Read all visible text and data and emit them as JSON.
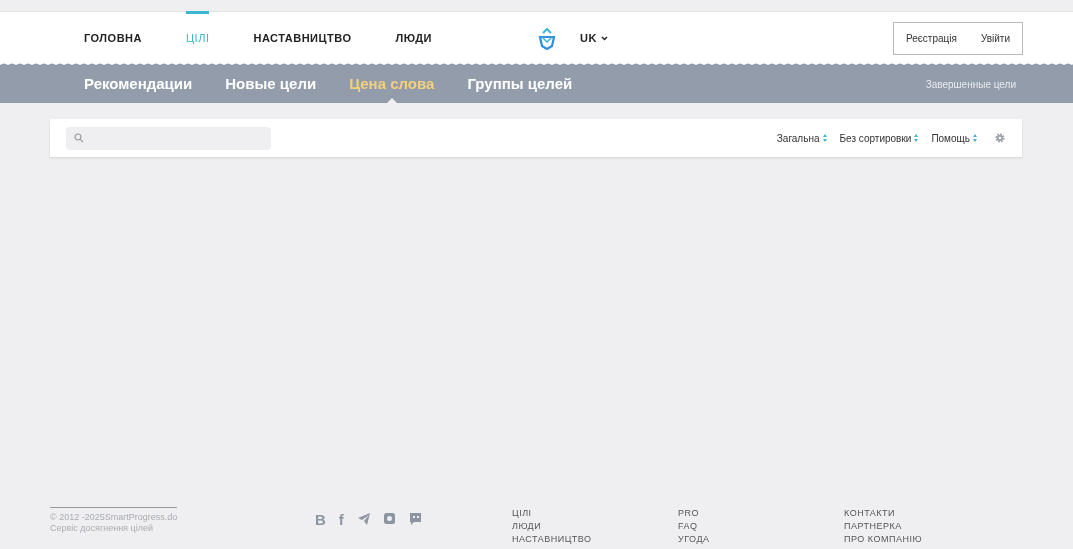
{
  "top_nav": {
    "items": [
      {
        "label": "ГОЛОВНА",
        "selected": false
      },
      {
        "label": "ЦІЛІ",
        "selected": true
      },
      {
        "label": "НАСТАВНИЦТВО",
        "selected": false
      },
      {
        "label": "ЛЮДИ",
        "selected": false
      }
    ],
    "language": "UK",
    "auth": [
      "Реєстрація",
      "Увійти"
    ]
  },
  "sub_nav": {
    "items": [
      {
        "label": "Рекомендации",
        "selected": false
      },
      {
        "label": "Новые цели",
        "selected": false
      },
      {
        "label": "Цена слова",
        "selected": true
      },
      {
        "label": "Группы целей",
        "selected": false
      }
    ],
    "right_link": "Завершенные цели"
  },
  "toolbar": {
    "filters": [
      "Загальна",
      "Без сортировки",
      "Помощь"
    ]
  },
  "footer": {
    "copyright": "© 2012 -2025SmartProgress.do",
    "tagline": "Сервіс досягнення цілей",
    "social": [
      {
        "kind": "text",
        "label": "B"
      },
      {
        "kind": "text",
        "label": "f"
      },
      {
        "kind": "telegram"
      },
      {
        "kind": "instagram"
      },
      {
        "kind": "chat"
      }
    ],
    "columns": [
      [
        "ЦІЛІ",
        "ЛЮДИ",
        "НАСТАВНИЦТВО"
      ],
      [
        "PRO",
        "FAQ",
        "УГОДА"
      ],
      [
        "КОНТАКТИ",
        "ПАРТНЕРКА",
        "ПРО КОМПАНІЮ"
      ]
    ]
  }
}
